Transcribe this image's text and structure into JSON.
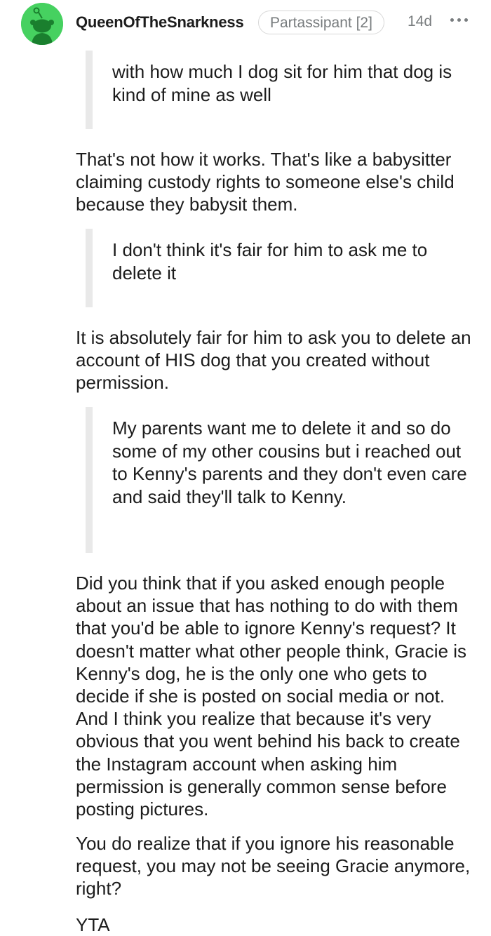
{
  "comment": {
    "author": "QueenOfTheSnarkness",
    "flair": "Partassipant [2]",
    "age": "14d",
    "more_icon": "more-horizontal-icon",
    "avatar_icon": "snoo-avatar-icon",
    "avatar_color": "#46d160",
    "blocks": [
      {
        "type": "quote",
        "text": "with how much I dog sit for him that dog is kind of mine as well"
      },
      {
        "type": "paragraph",
        "text": "That's not how it works. That's like a babysitter claiming custody rights to someone else's child because they babysit them."
      },
      {
        "type": "quote",
        "text": "I don't think it's fair for him to ask me to delete it"
      },
      {
        "type": "paragraph",
        "text": "It is absolutely fair for him to ask you to delete an account of HIS dog that you created without permission."
      },
      {
        "type": "quote",
        "text": "My parents want me to delete it and so do some of my other cousins but i reached out to Kenny's parents and they don't even care and said they'll talk to Kenny."
      },
      {
        "type": "paragraph",
        "text": "Did you think that if you asked enough people about an issue that has nothing to do with them that you'd be able to ignore Kenny's request? It doesn't matter what other people think, Gracie is Kenny's dog, he is the only one who gets to decide if she is posted on social media or not. And I think you realize that because it's very obvious that you went behind his back to create the Instagram account when asking him permission is generally common sense before posting pictures."
      },
      {
        "type": "paragraph",
        "text": "You do realize that if you ignore his reasonable request, you may not be seeing Gracie anymore, right?"
      },
      {
        "type": "paragraph",
        "text": "YTA"
      }
    ]
  }
}
